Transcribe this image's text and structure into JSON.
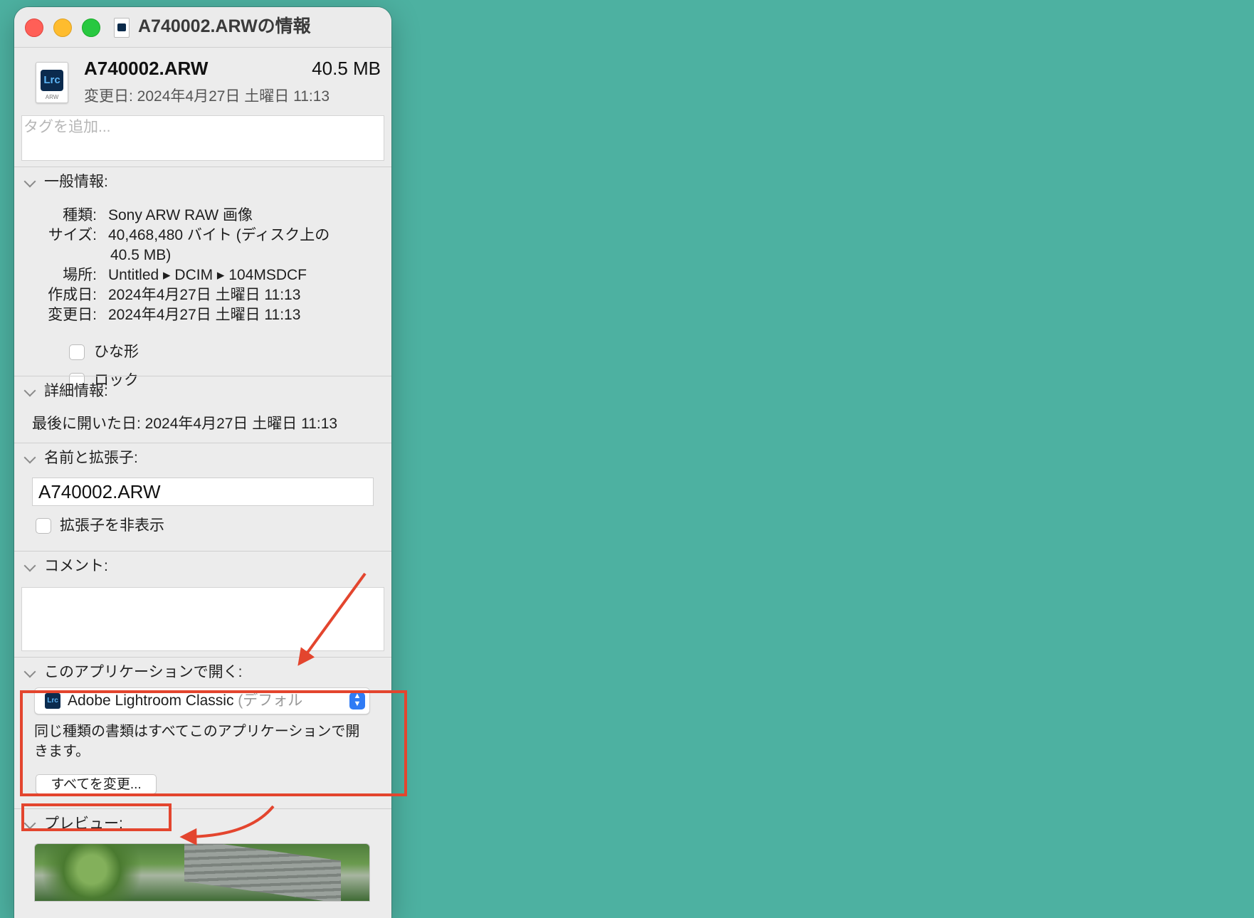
{
  "window": {
    "title": "A740002.ARWの情報"
  },
  "header": {
    "icon_label": "Lrc",
    "icon_ext": "ARW",
    "file_name": "A740002.ARW",
    "file_size": "40.5 MB",
    "modified": "変更日: 2024年4月27日 土曜日 11:13"
  },
  "tags": {
    "placeholder": "タグを追加..."
  },
  "general": {
    "heading": "一般情報:",
    "rows": [
      {
        "label": "種類:",
        "value": "Sony ARW RAW 画像"
      },
      {
        "label": "サイズ:",
        "value": "40,468,480 バイト (ディスク上の",
        "value2": "40.5 MB)"
      },
      {
        "label": "場所:",
        "value": "Untitled ▸ DCIM ▸ 104MSDCF"
      },
      {
        "label": "作成日:",
        "value": "2024年4月27日 土曜日 11:13"
      },
      {
        "label": "変更日:",
        "value": "2024年4月27日 土曜日 11:13"
      }
    ],
    "stationery_label": "ひな形",
    "locked_label": "ロック"
  },
  "more_info": {
    "heading": "詳細情報:",
    "last_opened": "最後に開いた日: 2024年4月27日 土曜日 11:13"
  },
  "name_ext": {
    "heading": "名前と拡張子:",
    "value": "A740002.ARW",
    "hide_ext_label": "拡張子を非表示"
  },
  "comments": {
    "heading": "コメント:"
  },
  "open_with": {
    "heading": "このアプリケーションで開く:",
    "app_icon": "Lrc",
    "app_name": "Adobe Lightroom Classic",
    "app_default": " (デフォル",
    "description": "同じ種類の書類はすべてこのアプリケーションで開きます。",
    "change_all_label": "すべてを変更..."
  },
  "preview": {
    "heading": "プレビュー:"
  },
  "colors": {
    "background": "#4DB1A1",
    "annotation": "#E3452E",
    "accent": "#2F7BF5"
  }
}
